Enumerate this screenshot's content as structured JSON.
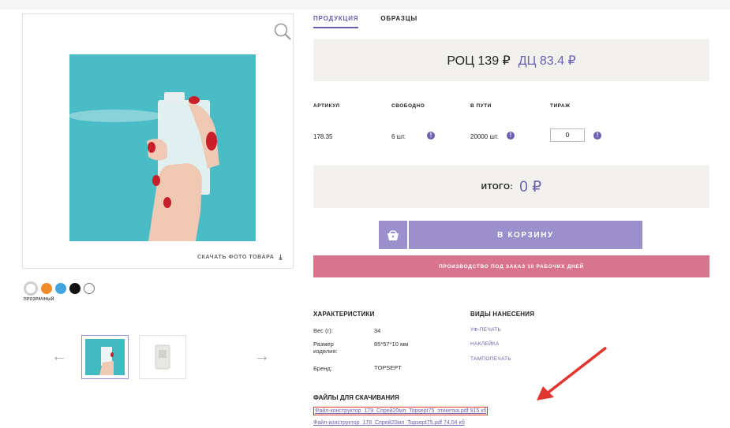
{
  "tabs": [
    {
      "label": "ПРОДУКЦИЯ",
      "active": true
    },
    {
      "label": "ОБРАЗЦЫ",
      "active": false
    }
  ],
  "photo": {
    "download_label": "СКАЧАТЬ ФОТО ТОВАРА",
    "zoom_icon": "magnifier-icon",
    "download_icon": "download-icon"
  },
  "colors": {
    "selected_label": "ПРОЗРАЧНЫЙ",
    "swatches": [
      "#ffffff",
      "#f08c2a",
      "#41a5e0",
      "#111111",
      "#ffffff"
    ]
  },
  "price": {
    "roc": "РОЦ 139 ₽",
    "dc": "ДЦ 83.4 ₽"
  },
  "specs": {
    "headers": [
      "АРТИКУЛ",
      "СВОБОДНО",
      "В ПУТИ",
      "ТИРАЖ"
    ],
    "article": "178.35",
    "free": "6 шт.",
    "in_transit": "20000 шт.",
    "quantity": "0"
  },
  "total": {
    "label": "ИТОГО:",
    "value": "0 ₽"
  },
  "cart": {
    "label": "В КОРЗИНУ",
    "icon": "basket-icon"
  },
  "production_notice": "ПРОИЗВОДСТВО ПОД ЗАКАЗ 10 РАБОЧИХ ДНЕЙ",
  "characteristics": {
    "title": "ХАРАКТЕРИСТИКИ",
    "rows": [
      {
        "label": "Вес (г):",
        "value": "34"
      },
      {
        "label": "Размер изделия:",
        "value": "85*57*10 мм"
      },
      {
        "label": "Бренд:",
        "value": "TOPSEPT"
      }
    ]
  },
  "application_methods": {
    "title": "ВИДЫ НАНЕСЕНИЯ",
    "items": [
      "УФ-ПЕЧАТЬ",
      "НАКЛЕЙКА",
      "ТАМПОПЕЧАТЬ"
    ]
  },
  "files": {
    "title": "ФАЙЛЫ ДЛЯ СКАЧИВАНИЯ",
    "items": [
      "Файл-конструктор_178_Спрей20мл_Topsept75_этикетка.pdf 915 кб",
      "Файл-конструктор_178_Спрей20мл_Topsept75.pdf 74.04 кб"
    ]
  },
  "accent_color": "#6d5fb0",
  "production_color": "#d9748f"
}
